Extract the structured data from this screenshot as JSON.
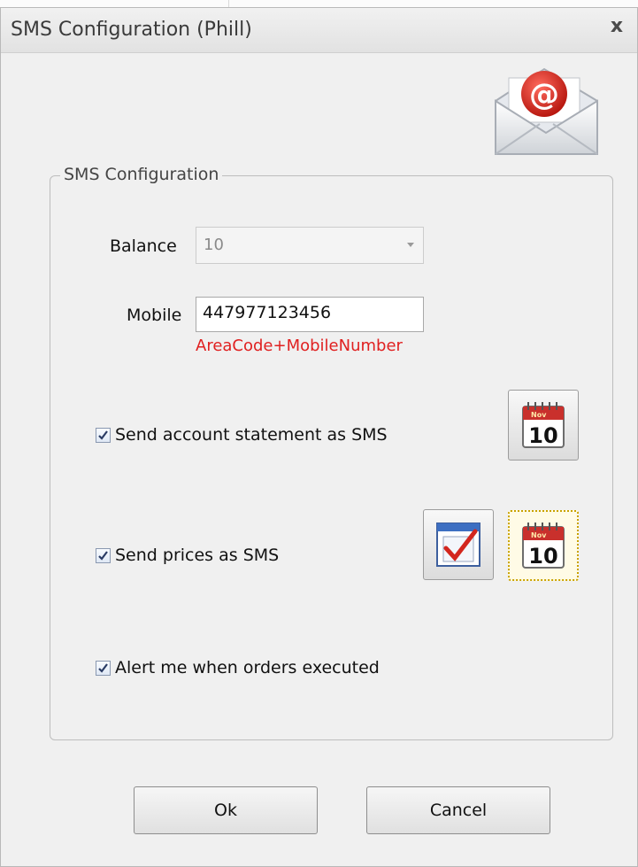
{
  "window": {
    "title": "SMS Configuration (Phill)",
    "close_glyph": "x"
  },
  "header_icon": {
    "name": "mail-at-icon",
    "symbol": "@"
  },
  "group": {
    "title": "SMS Configuration"
  },
  "balance": {
    "label": "Balance",
    "value": "10"
  },
  "mobile": {
    "label": "Mobile",
    "value": "447977123456",
    "hint": "AreaCode+MobileNumber"
  },
  "options": [
    {
      "label": "Send account statement as SMS",
      "checked": true
    },
    {
      "label": "Send prices as SMS",
      "checked": true
    },
    {
      "label": "Alert me when orders executed",
      "checked": true
    }
  ],
  "calendar_icon": {
    "month": "Nov",
    "day": "10"
  },
  "buttons": {
    "ok": "Ok",
    "cancel": "Cancel"
  },
  "colors": {
    "hint": "#e02020",
    "accent": "#c9302c"
  }
}
